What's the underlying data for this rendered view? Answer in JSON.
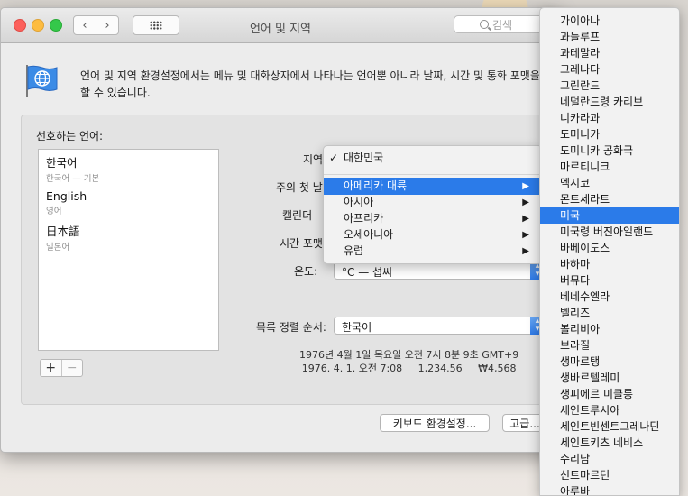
{
  "window": {
    "title": "언어 및 지역",
    "search_placeholder": "검색",
    "description": "언어 및 지역 환경설정에서는 메뉴 및 대화상자에서 나타나는 언어뿐 아니라 날짜, 시간 및 통화 포맷을 설정할 수 있습니다."
  },
  "languages": {
    "label": "선호하는 언어:",
    "items": [
      {
        "name": "한국어",
        "sub": "한국어 — 기본"
      },
      {
        "name": "English",
        "sub": "영어"
      },
      {
        "name": "日本語",
        "sub": "일본어"
      }
    ],
    "add": "+",
    "remove": "−"
  },
  "form": {
    "region_label": "지역",
    "first_day_label": "주의 첫 날",
    "calendar_label": "캘린더",
    "time_format_label": "시간 포맷",
    "temperature_label": "온도:",
    "temperature_value": "°C — 섭씨",
    "sort_label": "목록 정렬 순서:",
    "sort_value": "한국어"
  },
  "sample": {
    "line1": "1976년 4월 1일 목요일 오전 7시 8분 9초 GMT+9",
    "line2": "1976. 4. 1. 오전 7:08     1,234.56     ₩4,568"
  },
  "buttons": {
    "keyboard": "키보드 환경설정...",
    "advanced": "고급..."
  },
  "region_menu": {
    "checked": "대한민국",
    "items": [
      "아메리카 대륙",
      "아시아",
      "아프리카",
      "오세아니아",
      "유럽"
    ],
    "selected_index": 0
  },
  "america_submenu": {
    "items": [
      "가이아나",
      "과들루프",
      "과테말라",
      "그레나다",
      "그린란드",
      "네덜란드령 카리브",
      "니카라과",
      "도미니카",
      "도미니카 공화국",
      "마르티니크",
      "멕시코",
      "몬트세라트",
      "미국",
      "미국령 버진아일랜드",
      "바베이도스",
      "바하마",
      "버뮤다",
      "베네수엘라",
      "벨리즈",
      "볼리비아",
      "브라질",
      "생마르탱",
      "생바르텔레미",
      "생피에르 미클롱",
      "세인트루시아",
      "세인트빈센트그레나딘",
      "세인트키츠 네비스",
      "수리남",
      "신트마르턴",
      "아루바"
    ],
    "selected_index": 12
  }
}
